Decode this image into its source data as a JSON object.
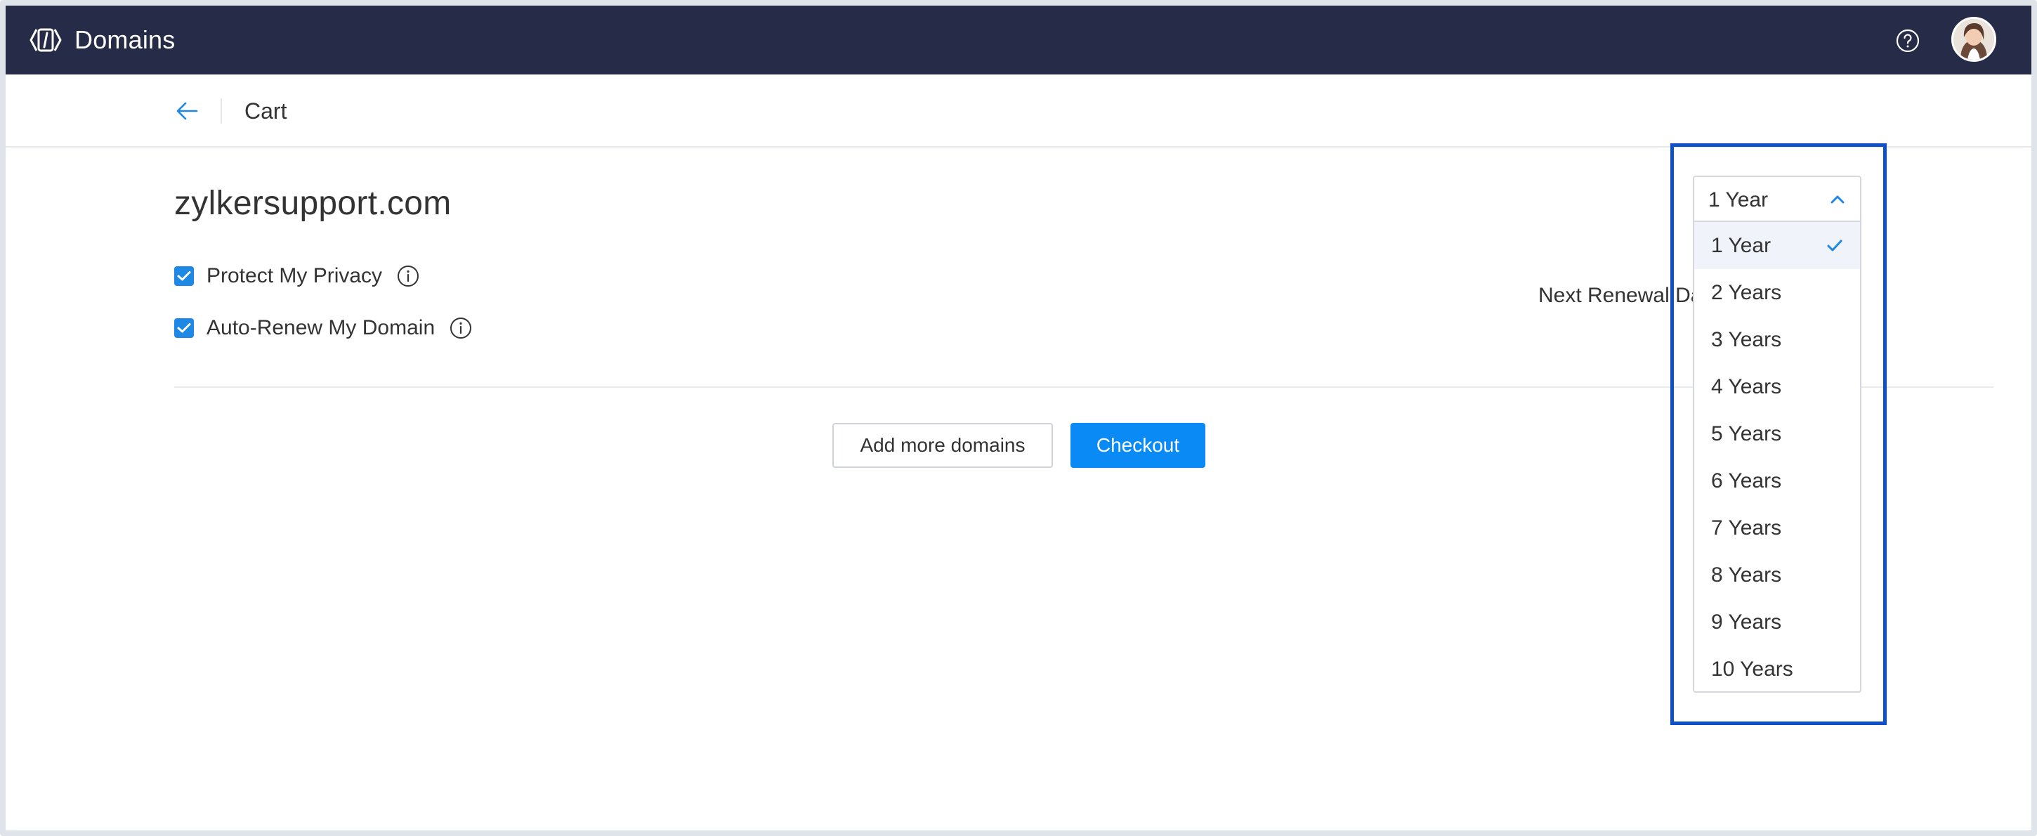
{
  "app": {
    "title": "Domains",
    "icons": {
      "brand": "domains-logo-icon",
      "help": "help-icon",
      "avatar": "user-avatar"
    }
  },
  "subheader": {
    "back_icon": "arrow-left-icon",
    "title": "Cart"
  },
  "cart_item": {
    "domain": "zylkersupport.com",
    "options": [
      {
        "label": "Protect My Privacy",
        "checked": true,
        "info_icon": "info-icon"
      },
      {
        "label": "Auto-Renew My Domain",
        "checked": true,
        "info_icon": "info-icon"
      }
    ],
    "renewal_label": "Next Renewal Da"
  },
  "actions": {
    "add_more_label": "Add more domains",
    "checkout_label": "Checkout"
  },
  "duration_select": {
    "selected": "1 Year",
    "expanded": true,
    "options": [
      "1 Year",
      "2 Years",
      "3 Years",
      "4 Years",
      "5 Years",
      "6 Years",
      "7 Years",
      "8 Years",
      "9 Years",
      "10 Years"
    ]
  },
  "colors": {
    "topbar": "#262b47",
    "accent": "#0a8af5",
    "highlight_border": "#0d50c8"
  }
}
